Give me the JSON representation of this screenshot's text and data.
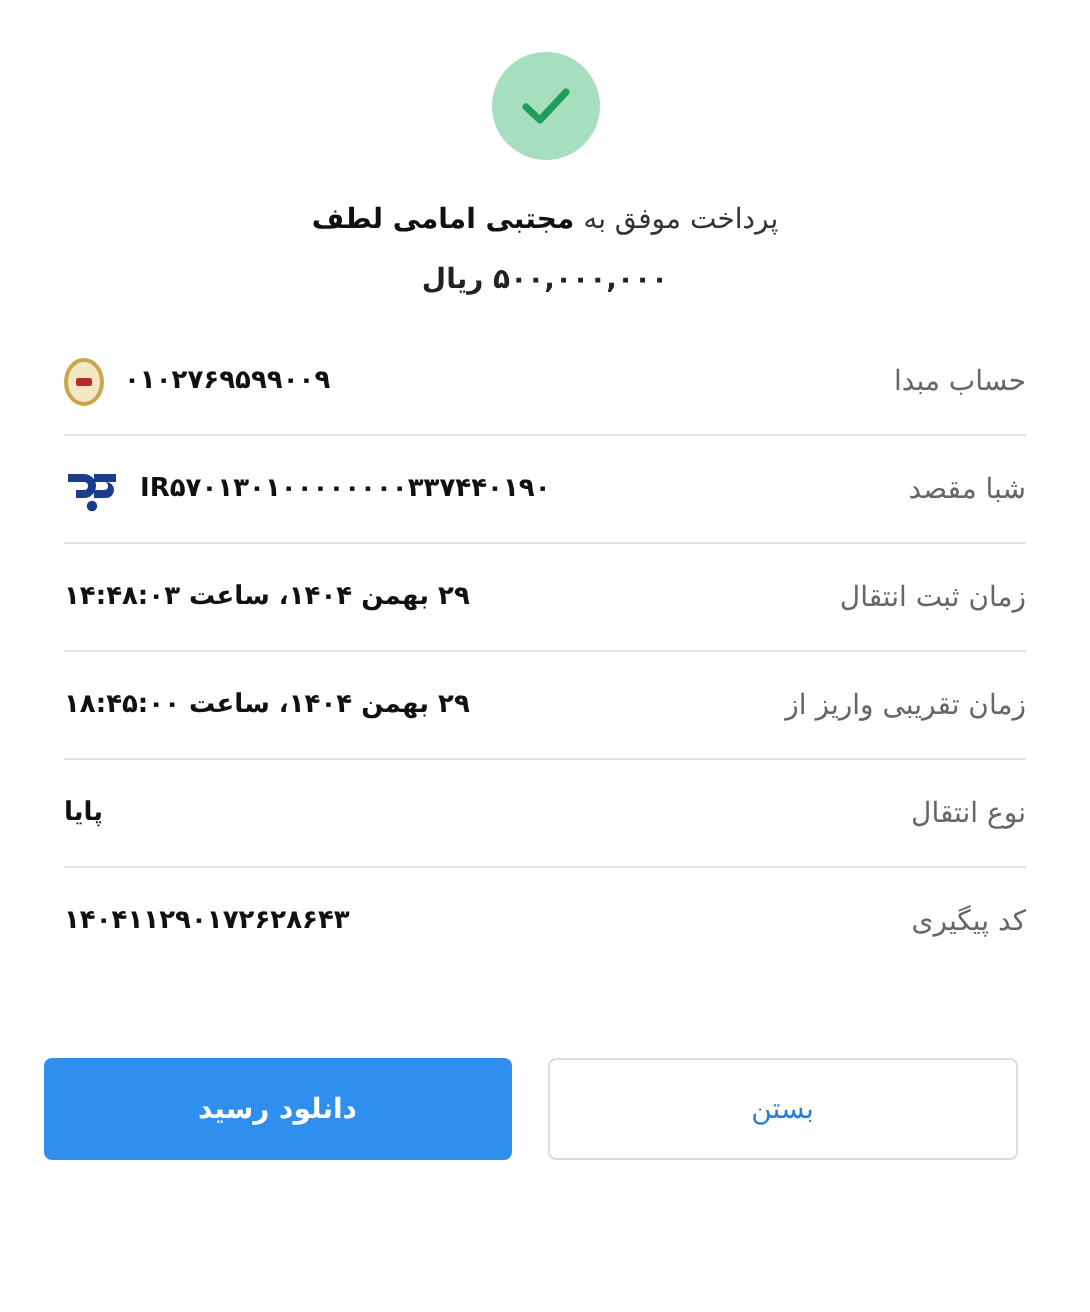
{
  "status": {
    "kind": "success"
  },
  "title": "پرداخت موفق به **مجتبی امامی لطف**",
  "amount": "۵۰۰,۰۰۰,۰۰۰ ریال",
  "details": [
    {
      "kind": "account",
      "label": "حساب مبدا",
      "value": "۰۱۰۲۷۶۹۵۹۹۰۰۹"
    },
    {
      "kind": "iban",
      "label": "شبا مقصد",
      "value": "IR۵۷۰۱۳۰۱۰۰۰۰۰۰۰۰۳۳۷۴۴۰۱۹۰"
    },
    {
      "kind": "text",
      "label": "زمان ثبت انتقال",
      "value": "۲۹ بهمن ۱۴۰۴، ساعت ۱۴:۴۸:۰۳"
    },
    {
      "kind": "text",
      "label": "زمان تقریبی واریز از",
      "value": "۲۹ بهمن ۱۴۰۴، ساعت ۱۸:۴۵:۰۰"
    },
    {
      "kind": "text",
      "label": "نوع انتقال",
      "value": "پایا"
    },
    {
      "kind": "text",
      "label": "کد پیگیری",
      "value": "۱۴۰۴۱۱۲۹۰۱۷۲۶۲۸۶۴۳"
    }
  ],
  "buttons": [
    {
      "kind": "secondary",
      "label": "بستن"
    },
    {
      "kind": "primary",
      "label": "دانلود رسید"
    }
  ]
}
